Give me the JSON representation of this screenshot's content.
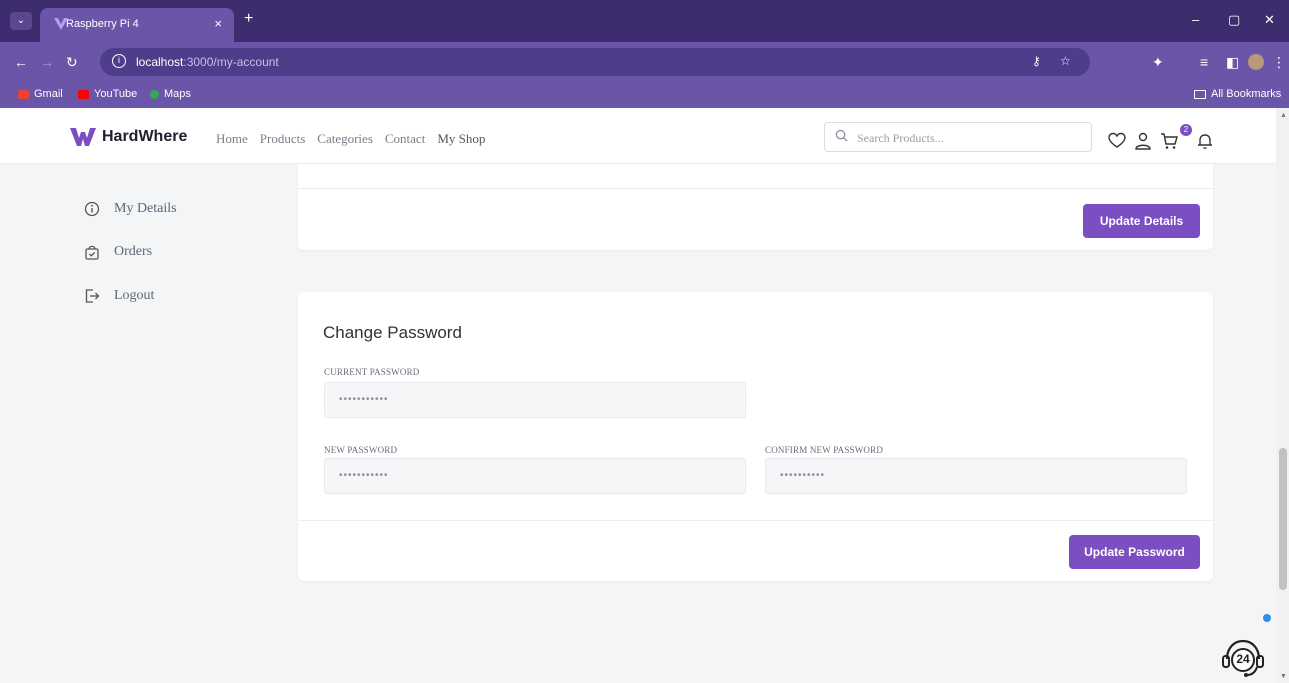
{
  "browser": {
    "tab_menu_icon": "chevron-down-icon",
    "tab_title": "Raspberry Pi 4",
    "tab_close": "×",
    "new_tab": "+",
    "window_controls": {
      "minimize": "–",
      "restore": "▢",
      "close": "✕"
    },
    "url_host": "localhost",
    "url_path": ":3000/my-account",
    "bookmarks": [
      {
        "label": "Gmail",
        "color": "#ea4335"
      },
      {
        "label": "YouTube",
        "color": "#ff0000"
      },
      {
        "label": "Maps",
        "color": "#34a853"
      }
    ],
    "all_bookmarks": "All Bookmarks"
  },
  "header": {
    "logo_text": "HardWhere",
    "brand_color": "#7b4fc2",
    "nav": [
      "Home",
      "Products",
      "Categories",
      "Contact",
      "My Shop"
    ],
    "search_placeholder": "Search Products...",
    "cart_count": "2"
  },
  "sidebar": {
    "items": [
      {
        "label": "My Details",
        "icon": "info-icon"
      },
      {
        "label": "Orders",
        "icon": "bag-check-icon"
      },
      {
        "label": "Logout",
        "icon": "logout-icon"
      }
    ]
  },
  "details_card": {
    "button": "Update Details"
  },
  "password_card": {
    "title": "Change Password",
    "current_label": "CURRENT PASSWORD",
    "current_value": "•••••••••••",
    "new_label": "NEW PASSWORD",
    "new_value": "•••••••••••",
    "confirm_label": "CONFIRM NEW PASSWORD",
    "confirm_value": "••••••••••",
    "button": "Update Password"
  },
  "support_widget": {
    "label": "24"
  }
}
